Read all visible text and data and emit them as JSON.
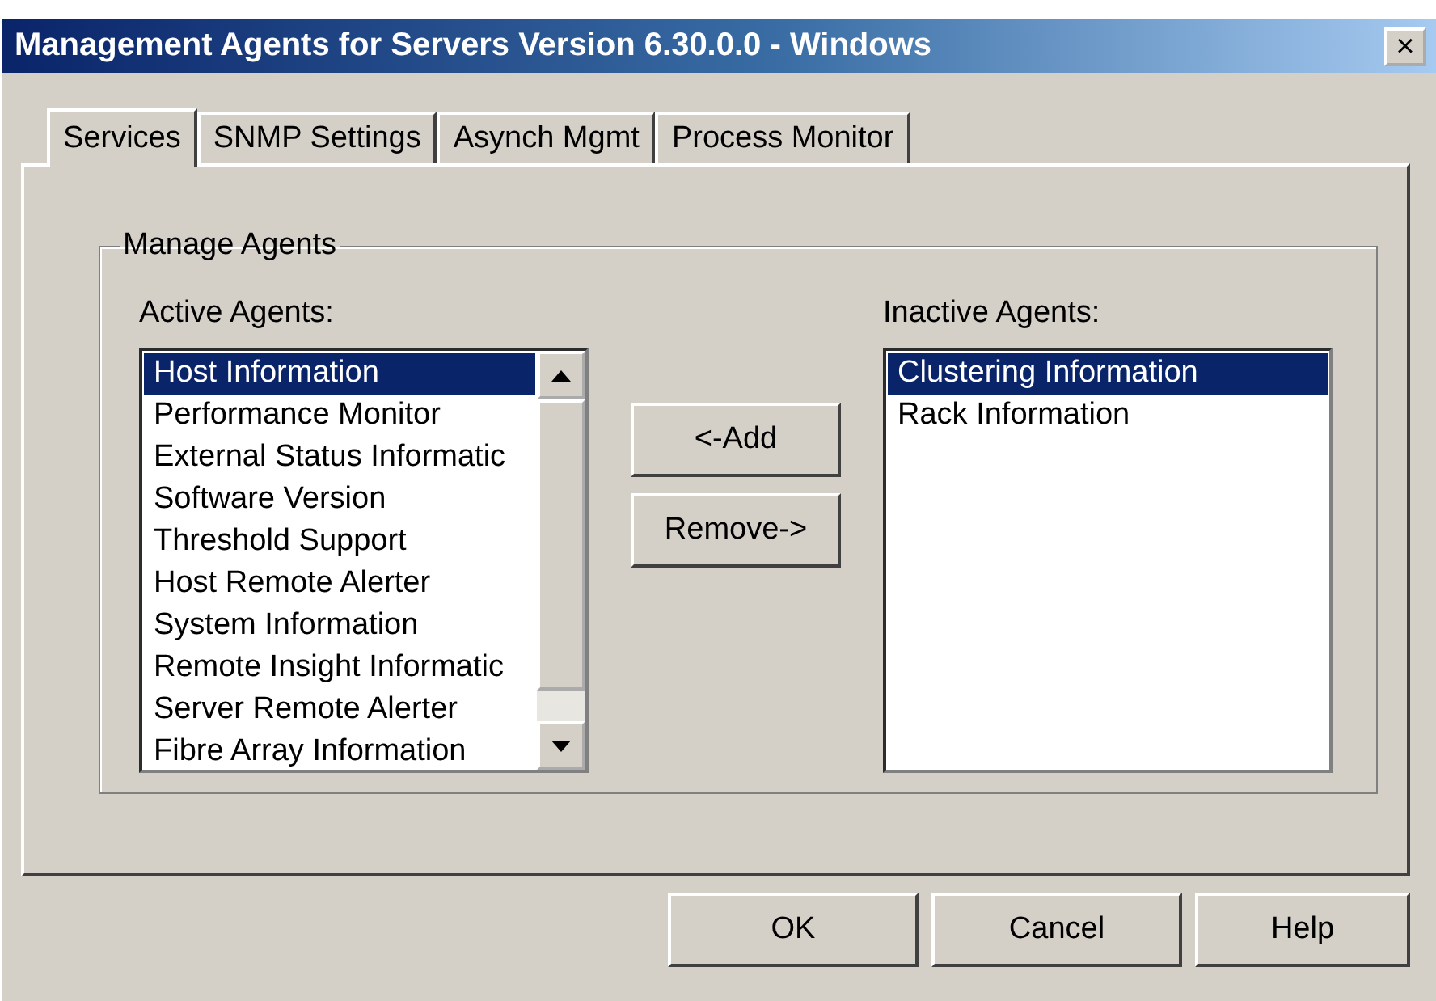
{
  "window": {
    "title": "Management Agents for Servers Version 6.30.0.0 - Windows",
    "close": "×"
  },
  "tabs": [
    {
      "label": "Services",
      "selected": true
    },
    {
      "label": "SNMP Settings",
      "selected": false
    },
    {
      "label": "Asynch Mgmt",
      "selected": false
    },
    {
      "label": "Process Monitor",
      "selected": false
    }
  ],
  "group": {
    "title": "Manage Agents"
  },
  "active_agents": {
    "label": "Active Agents:",
    "items": [
      {
        "label": "Host Information",
        "selected": true
      },
      {
        "label": "Performance Monitor",
        "selected": false
      },
      {
        "label": "External Status Informatic",
        "selected": false
      },
      {
        "label": "Software Version",
        "selected": false
      },
      {
        "label": "Threshold Support",
        "selected": false
      },
      {
        "label": "Host Remote Alerter",
        "selected": false
      },
      {
        "label": "System Information",
        "selected": false
      },
      {
        "label": "Remote Insight Informatic",
        "selected": false
      },
      {
        "label": "Server Remote Alerter",
        "selected": false
      },
      {
        "label": "Fibre Array Information",
        "selected": false
      }
    ]
  },
  "move_buttons": [
    "<-Add",
    "Remove->"
  ],
  "inactive_agents": {
    "label": "Inactive Agents:",
    "items": [
      {
        "label": "Clustering Information",
        "selected": true
      },
      {
        "label": "Rack Information",
        "selected": false
      }
    ]
  },
  "buttons": [
    "OK",
    "Cancel",
    "Help"
  ]
}
